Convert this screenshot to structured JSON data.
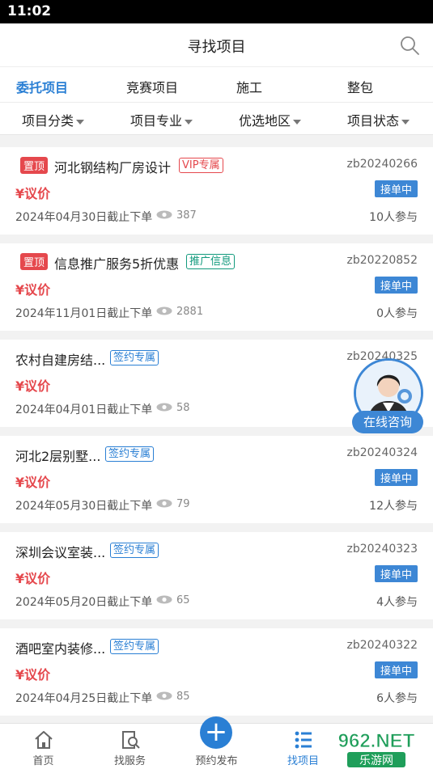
{
  "statusbar": {
    "time": "11:02"
  },
  "header": {
    "title": "寻找项目"
  },
  "tabs": [
    {
      "label": "委托项目",
      "active": true
    },
    {
      "label": "竞赛项目",
      "active": false
    },
    {
      "label": "施工",
      "active": false
    },
    {
      "label": "整包",
      "active": false
    }
  ],
  "filters": [
    {
      "label": "项目分类"
    },
    {
      "label": "项目专业"
    },
    {
      "label": "优选地区"
    },
    {
      "label": "项目状态"
    }
  ],
  "projects": [
    {
      "top_tag": "置顶",
      "title": "河北钢结构厂房设计",
      "badge": "VIP专属",
      "badge_color": "#e5484d",
      "code": "zb20240266",
      "price": "¥议价",
      "status": "接单中",
      "deadline": "2024年04月30日截止下单",
      "views": "387",
      "participants": "10人参与"
    },
    {
      "top_tag": "置顶",
      "title": "信息推广服务5折优惠",
      "badge": "推广信息",
      "badge_color": "#129a7d",
      "code": "zb20220852",
      "price": "¥议价",
      "status": "接单中",
      "deadline": "2024年11月01日截止下单",
      "views": "2881",
      "participants": "0人参与"
    },
    {
      "top_tag": "",
      "title": "农村自建房结...",
      "badge": "签约专属",
      "badge_color": "#2a7fd4",
      "code": "zb20240325",
      "price": "¥议价",
      "status": "",
      "deadline": "2024年04月01日截止下单",
      "views": "58",
      "participants": ""
    },
    {
      "top_tag": "",
      "title": "河北2层别墅...",
      "badge": "签约专属",
      "badge_color": "#2a7fd4",
      "code": "zb20240324",
      "price": "¥议价",
      "status": "接单中",
      "deadline": "2024年05月30日截止下单",
      "views": "79",
      "participants": "12人参与"
    },
    {
      "top_tag": "",
      "title": "深圳会议室装...",
      "badge": "签约专属",
      "badge_color": "#2a7fd4",
      "code": "zb20240323",
      "price": "¥议价",
      "status": "接单中",
      "deadline": "2024年05月20日截止下单",
      "views": "65",
      "participants": "4人参与"
    },
    {
      "top_tag": "",
      "title": "酒吧室内装修...",
      "badge": "签约专属",
      "badge_color": "#2a7fd4",
      "code": "zb20240322",
      "price": "¥议价",
      "status": "接单中",
      "deadline": "2024年04月25日截止下单",
      "views": "85",
      "participants": "6人参与"
    }
  ],
  "consult": {
    "label": "在线咨询"
  },
  "bottom_nav": [
    {
      "label": "首页",
      "icon": "home-icon"
    },
    {
      "label": "找服务",
      "icon": "service-icon"
    },
    {
      "label": "预约发布",
      "icon": "plus-icon"
    },
    {
      "label": "找项目",
      "icon": "list-icon",
      "active": true
    }
  ],
  "watermark": {
    "text": "962.NET",
    "subtext": "乐游网"
  },
  "colors": {
    "accent": "#2a7fd4",
    "price": "#e5484d",
    "status_bg": "#3d87d5"
  }
}
